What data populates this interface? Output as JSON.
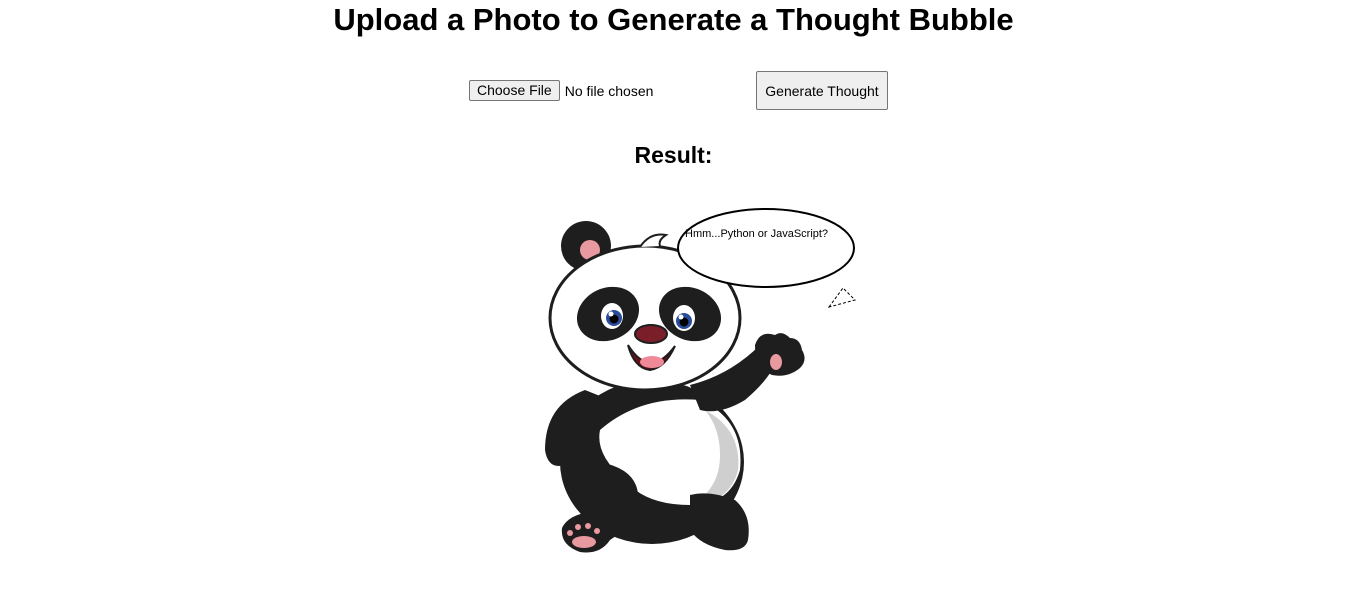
{
  "page": {
    "title": "Upload a Photo to Generate a Thought Bubble"
  },
  "upload": {
    "choose_label": "Choose File",
    "status": "No file chosen"
  },
  "actions": {
    "generate_label": "Generate Thought"
  },
  "result": {
    "heading": "Result:",
    "thought": "Hmm...Python or JavaScript?",
    "image_subject": "panda-cartoon"
  }
}
